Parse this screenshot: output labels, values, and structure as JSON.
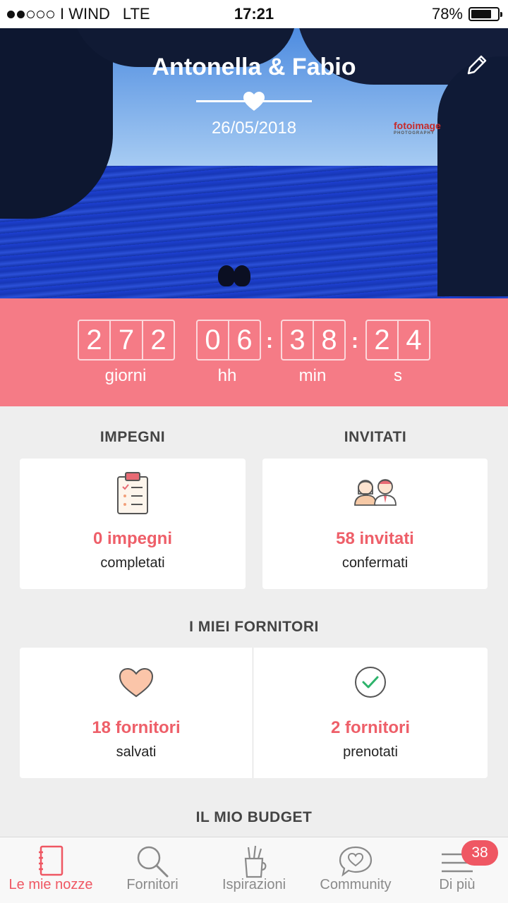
{
  "status_bar": {
    "carrier": "I WIND",
    "network": "LTE",
    "time": "17:21",
    "battery": "78%",
    "battery_level": 0.78,
    "signal_bars_filled": 2,
    "signal_bars_total": 5
  },
  "hero": {
    "couple": "Antonella & Fabio",
    "date": "26/05/2018",
    "photo_logo": "fotoimage",
    "edit_icon": "pencil-icon",
    "divider_icon": "heart-icon"
  },
  "countdown": {
    "days": [
      "2",
      "7",
      "2"
    ],
    "hours": [
      "0",
      "6"
    ],
    "minutes": [
      "3",
      "8"
    ],
    "seconds": [
      "2",
      "4"
    ],
    "separator": ":",
    "labels": {
      "days": "giorni",
      "hours": "hh",
      "minutes": "min",
      "seconds": "s"
    }
  },
  "impegni": {
    "title": "IMPEGNI",
    "value": "0 impegni",
    "sub": "completati",
    "icon": "clipboard-icon"
  },
  "invitati": {
    "title": "INVITATI",
    "value": "58 invitati",
    "sub": "confermati",
    "icon": "guests-icon"
  },
  "fornitori": {
    "title": "I MIEI FORNITORI",
    "saved": {
      "value": "18 fornitori",
      "sub": "salvati",
      "icon": "heart-icon"
    },
    "booked": {
      "value": "2 fornitori",
      "sub": "prenotati",
      "icon": "check-circle-icon"
    }
  },
  "budget": {
    "title": "IL MIO BUDGET"
  },
  "tabbar": {
    "tabs": [
      {
        "label": "Le mie nozze",
        "icon": "notebook-icon",
        "active": true
      },
      {
        "label": "Fornitori",
        "icon": "search-icon",
        "active": false
      },
      {
        "label": "Ispirazioni",
        "icon": "pencil-cup-icon",
        "active": false
      },
      {
        "label": "Community",
        "icon": "chat-heart-icon",
        "active": false
      },
      {
        "label": "Di più",
        "icon": "menu-icon",
        "active": false
      }
    ],
    "badge": "38"
  },
  "colors": {
    "accent": "#ef5763",
    "countdown_bg": "#f57b86",
    "value_text": "#ee5f69",
    "background": "#eeeeee"
  }
}
